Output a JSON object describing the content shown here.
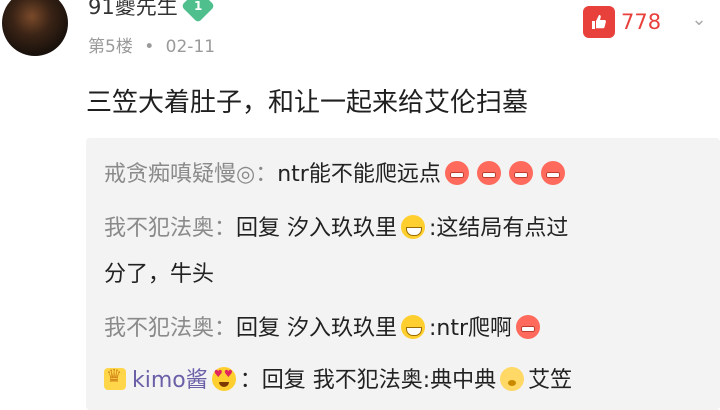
{
  "post": {
    "username": "91夔先生",
    "level": "1",
    "floor": "第5楼",
    "separator": "•",
    "date": "02-11",
    "likes": "778",
    "content": "三笠大着肚子，和让一起来给艾伦扫墓"
  },
  "replies": [
    {
      "user": "戒贪痴嗔疑慢◎：",
      "text": "ntr能不能爬远点",
      "emojis": [
        "grimace-icon",
        "grimace-icon",
        "grimace-icon",
        "grimace-icon"
      ]
    },
    {
      "user": "我不犯法奥：",
      "prefix": "回复 汐入玖玖里",
      "text": ":这结局有点过",
      "continuation": "分了，牛头"
    },
    {
      "user": "我不犯法奥：",
      "prefix": "回复 汐入玖玖里",
      "text": ":ntr爬啊"
    },
    {
      "user": "kimo酱",
      "prefix": "：回复 我不犯法奥",
      "text": ":典中典",
      "suffix": "艾笠"
    }
  ],
  "colors": {
    "accent_red": "#e8413b",
    "level_green": "#4fc08d",
    "reply_bg": "#f3f3f3",
    "username_gray": "#8a8a8a"
  }
}
